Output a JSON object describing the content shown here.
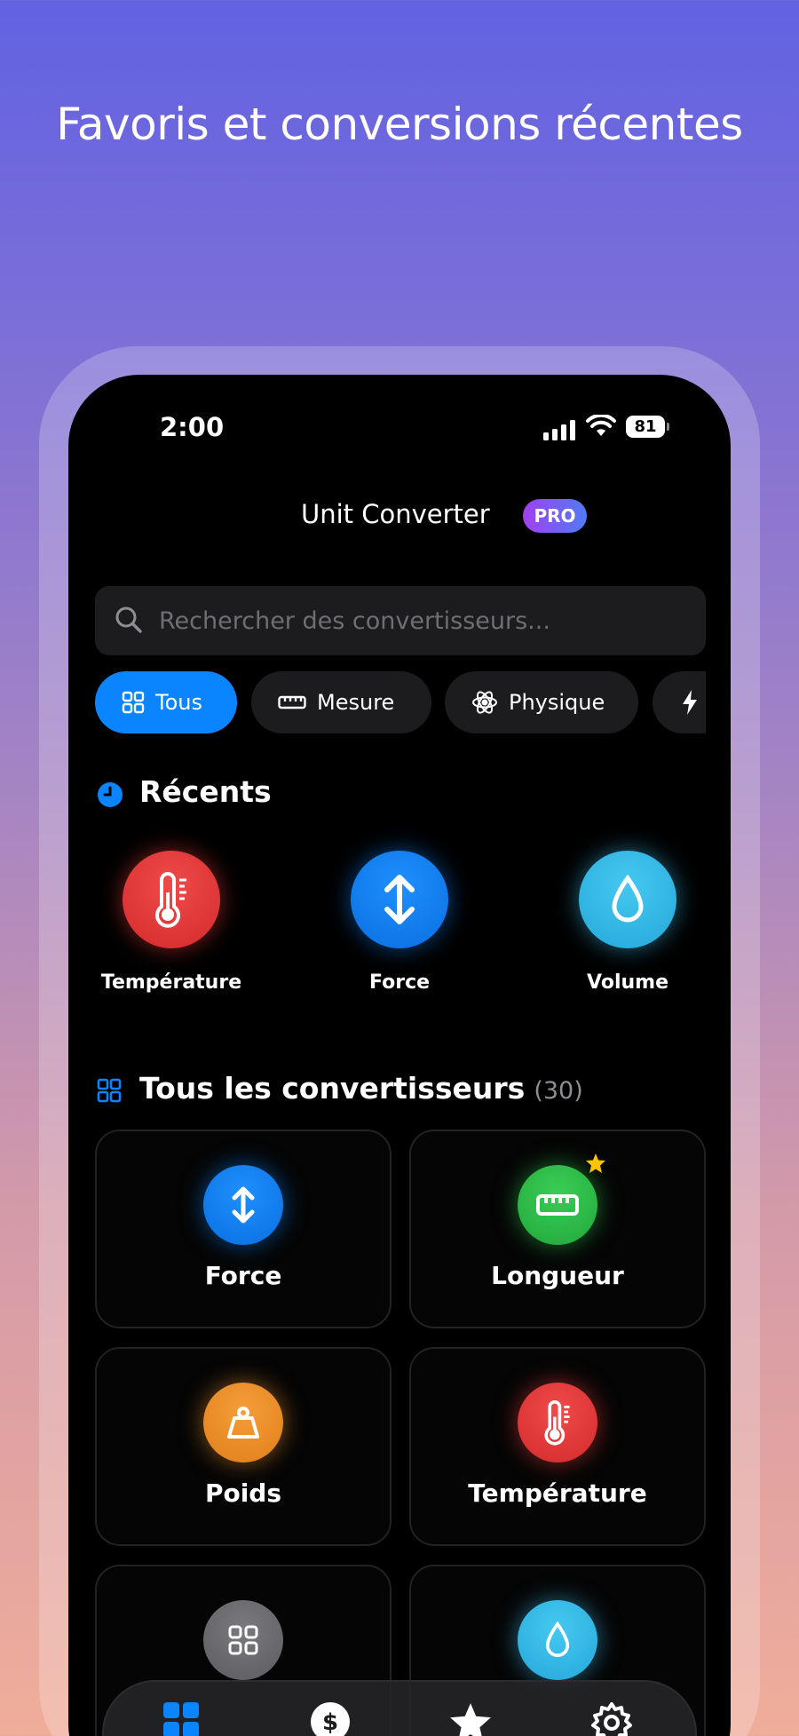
{
  "headline": "Favoris et conversions récentes",
  "status": {
    "time": "2:00",
    "battery": "81"
  },
  "header": {
    "title": "Unit Converter",
    "badge": "PRO"
  },
  "search": {
    "placeholder": "Rechercher des convertisseurs..."
  },
  "chips": [
    {
      "label": "Tous",
      "icon": "grid-icon",
      "active": true
    },
    {
      "label": "Mesure",
      "icon": "ruler-icon"
    },
    {
      "label": "Physique",
      "icon": "atom-icon"
    },
    {
      "label": "",
      "icon": "bolt-icon"
    }
  ],
  "recents": {
    "title": "Récents",
    "items": [
      {
        "label": "Température",
        "icon": "thermometer-icon",
        "color": "#e53935"
      },
      {
        "label": "Force",
        "icon": "arrows-updown-icon",
        "color": "#0a84ff"
      },
      {
        "label": "Volume",
        "icon": "drop-icon",
        "color": "#35b8e8"
      }
    ]
  },
  "all": {
    "title": "Tous les convertisseurs",
    "count": "(30)",
    "items": [
      {
        "label": "Force",
        "icon": "arrows-updown-icon",
        "color": "#0a84ff"
      },
      {
        "label": "Longueur",
        "icon": "ruler-icon",
        "color": "#30c048",
        "favorite": true
      },
      {
        "label": "Poids",
        "icon": "weight-icon",
        "color": "#f0912a"
      },
      {
        "label": "Température",
        "icon": "thermometer-icon",
        "color": "#e53935"
      },
      {
        "label": "",
        "icon": "grid-icon",
        "color": "#6b6b70"
      },
      {
        "label": "",
        "icon": "drop-icon",
        "color": "#35b8e8"
      }
    ]
  },
  "tabbar": [
    {
      "name": "converters",
      "icon": "grid-icon",
      "color": "#0a84ff"
    },
    {
      "name": "currency",
      "icon": "dollar-icon"
    },
    {
      "name": "favorites",
      "icon": "star-icon"
    },
    {
      "name": "settings",
      "icon": "gear-icon"
    }
  ]
}
